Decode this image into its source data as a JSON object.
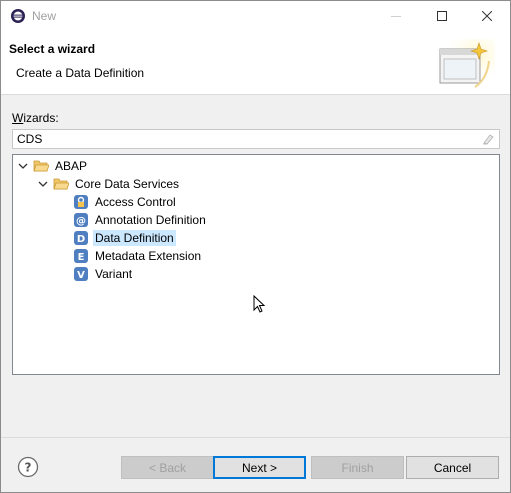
{
  "window": {
    "title": "New"
  },
  "header": {
    "title": "Select a wizard",
    "description": "Create a Data Definition"
  },
  "wizards": {
    "label_accel": "W",
    "label_rest": "izards:",
    "filter_value": "CDS"
  },
  "tree": {
    "root": {
      "label": "ABAP",
      "expanded": true
    },
    "group": {
      "label": "Core Data Services",
      "expanded": true
    },
    "items": [
      {
        "label": "Access Control",
        "icon": "access-control-icon"
      },
      {
        "label": "Annotation Definition",
        "icon": "annotation-definition-icon"
      },
      {
        "label": "Data Definition",
        "icon": "data-definition-icon",
        "selected": true
      },
      {
        "label": "Metadata Extension",
        "icon": "metadata-extension-icon"
      },
      {
        "label": "Variant",
        "icon": "variant-icon"
      }
    ]
  },
  "buttons": {
    "back": "< Back",
    "next": "Next >",
    "finish": "Finish",
    "cancel": "Cancel"
  },
  "colors": {
    "selection": "#cce8ff",
    "accent": "#0078d7",
    "folder": "#e8b84a"
  }
}
